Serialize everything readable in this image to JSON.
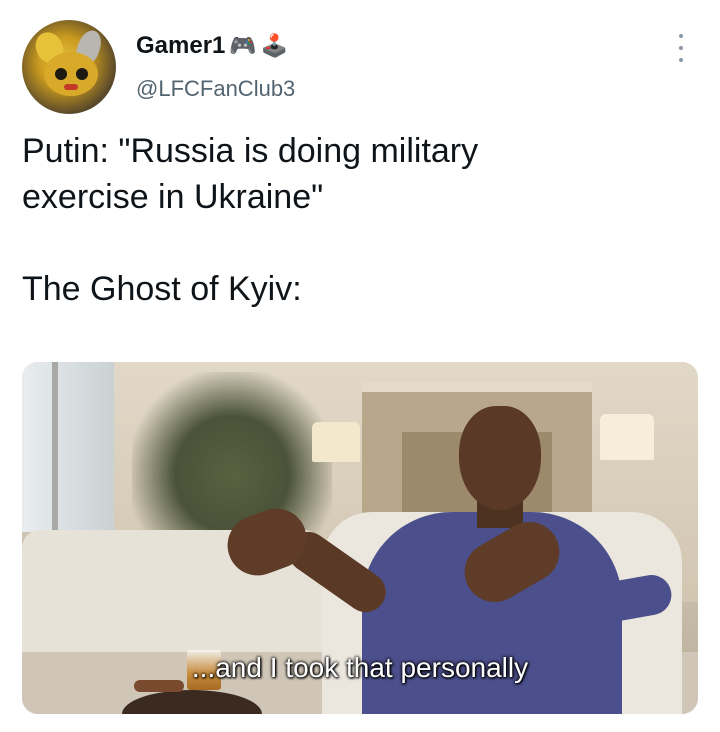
{
  "author": {
    "display_name": "Gamer1",
    "name_emojis": [
      "🎮",
      "🕹️"
    ],
    "handle": "@LFCFanClub3",
    "avatar_icon": "pikachu-detective-avatar"
  },
  "tweet": {
    "text_line1": "Putin: \"Russia is doing military",
    "text_line2": "exercise in Ukraine\"",
    "text_line3": "The Ghost of Kyiv:"
  },
  "media": {
    "caption": "...and I took that personally"
  },
  "icons": {
    "more": "more-options-icon"
  },
  "colors": {
    "text_primary": "#0f1419",
    "text_secondary": "#536471",
    "background": "#ffffff"
  }
}
